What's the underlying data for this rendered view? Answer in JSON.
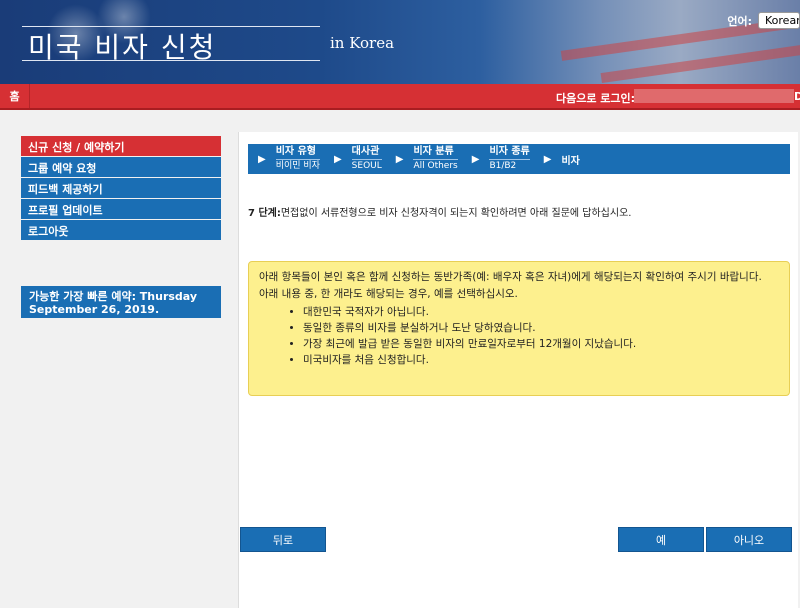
{
  "header": {
    "title": "미국 비자 신청",
    "subtitle": "in Korea",
    "lang_label": "언어:",
    "lang_value": "Korean"
  },
  "topbar": {
    "home": "홈",
    "login_label": "다음으로 로그인:",
    "login_end": "D"
  },
  "sidebar": {
    "items": [
      {
        "label": "신규 신청 / 예약하기",
        "active": true
      },
      {
        "label": "그룹 예약 요청"
      },
      {
        "label": "피드백 제공하기"
      },
      {
        "label": "프로필 업데이트"
      },
      {
        "label": "로그아웃"
      }
    ],
    "note": "가능한 가장 빠른 예약: Thursday September 26, 2019."
  },
  "breadcrumb": [
    {
      "title": "비자 유형",
      "value": "비이민 비자"
    },
    {
      "title": "대사관",
      "value": "SEOUL"
    },
    {
      "title": "비자 분류",
      "value": "All Others"
    },
    {
      "title": "비자 종류",
      "value": "B1/B2"
    },
    {
      "title": "비자",
      "value": ""
    }
  ],
  "step": {
    "label": "7 단계:",
    "text": "면접없이 서류전형으로 비자 신청자격이 되는지 확인하려면 아래 질문에 답하십시오."
  },
  "notice": {
    "intro1": "아래 항목들이 본인 혹은 함께 신청하는 동반가족(예: 배우자 혹은 자녀)에게 해당되는지 확인하여 주시기 바랍니다.",
    "intro2": "아래 내용 중, 한 개라도 해당되는 경우, 예를 선택하십시오.",
    "items": [
      "대한민국 국적자가 아닙니다.",
      "동일한 종류의 비자를 분실하거나 도난 당하였습니다.",
      "가장 최근에 발급 받은 동일한 비자의 만료일자로부터 12개월이 지났습니다.",
      "미국비자를 처음 신청합니다."
    ]
  },
  "buttons": {
    "back": "뒤로",
    "yes": "예",
    "no": "아니오"
  }
}
